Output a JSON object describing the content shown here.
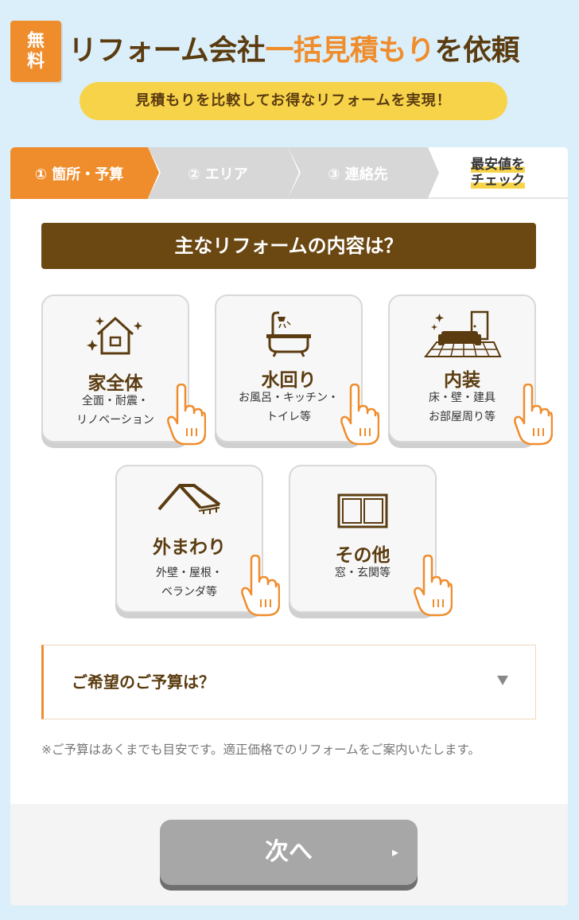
{
  "header": {
    "badge": [
      "無",
      "料"
    ],
    "headline_part1": "リフォーム会社",
    "headline_accent": "一括見積もり",
    "headline_part2": "を依頼",
    "subpill": "見積もりを比較してお得なリフォームを実現！"
  },
  "steps": [
    {
      "label": "① 箇所・予算",
      "active": true
    },
    {
      "label": "② エリア",
      "active": false
    },
    {
      "label": "③ 連絡先",
      "active": false
    },
    {
      "label_lines": [
        "最安値を",
        "チェック"
      ],
      "active": false
    }
  ],
  "question": "主なリフォームの内容は？",
  "options": [
    {
      "title": "家全体",
      "desc": [
        "全面・耐震・",
        "リノベーション"
      ],
      "icon": "house-icon"
    },
    {
      "title": "水回り",
      "desc": [
        "お風呂・キッチン・",
        "トイレ等"
      ],
      "icon": "bathtub-icon"
    },
    {
      "title": "内装",
      "desc": [
        "床・壁・建具",
        "お部屋周り等"
      ],
      "icon": "interior-icon"
    },
    {
      "title": "外まわり",
      "desc": [
        "外壁・屋根・",
        "ベランダ等"
      ],
      "icon": "roof-icon"
    },
    {
      "title": "その他",
      "desc": [
        "窓・玄関等"
      ],
      "icon": "window-icon"
    }
  ],
  "budget_select": {
    "label": "ご希望のご予算は？"
  },
  "note": "※ご予算はあくまでも目安です。適正価格でのリフォームをご案内いたします。",
  "next_button": {
    "label": "次へ"
  },
  "colors": {
    "accent": "#ef8d2d",
    "brown": "#6b4712",
    "yellow": "#f7d34a",
    "bg": "#dbeffa"
  }
}
